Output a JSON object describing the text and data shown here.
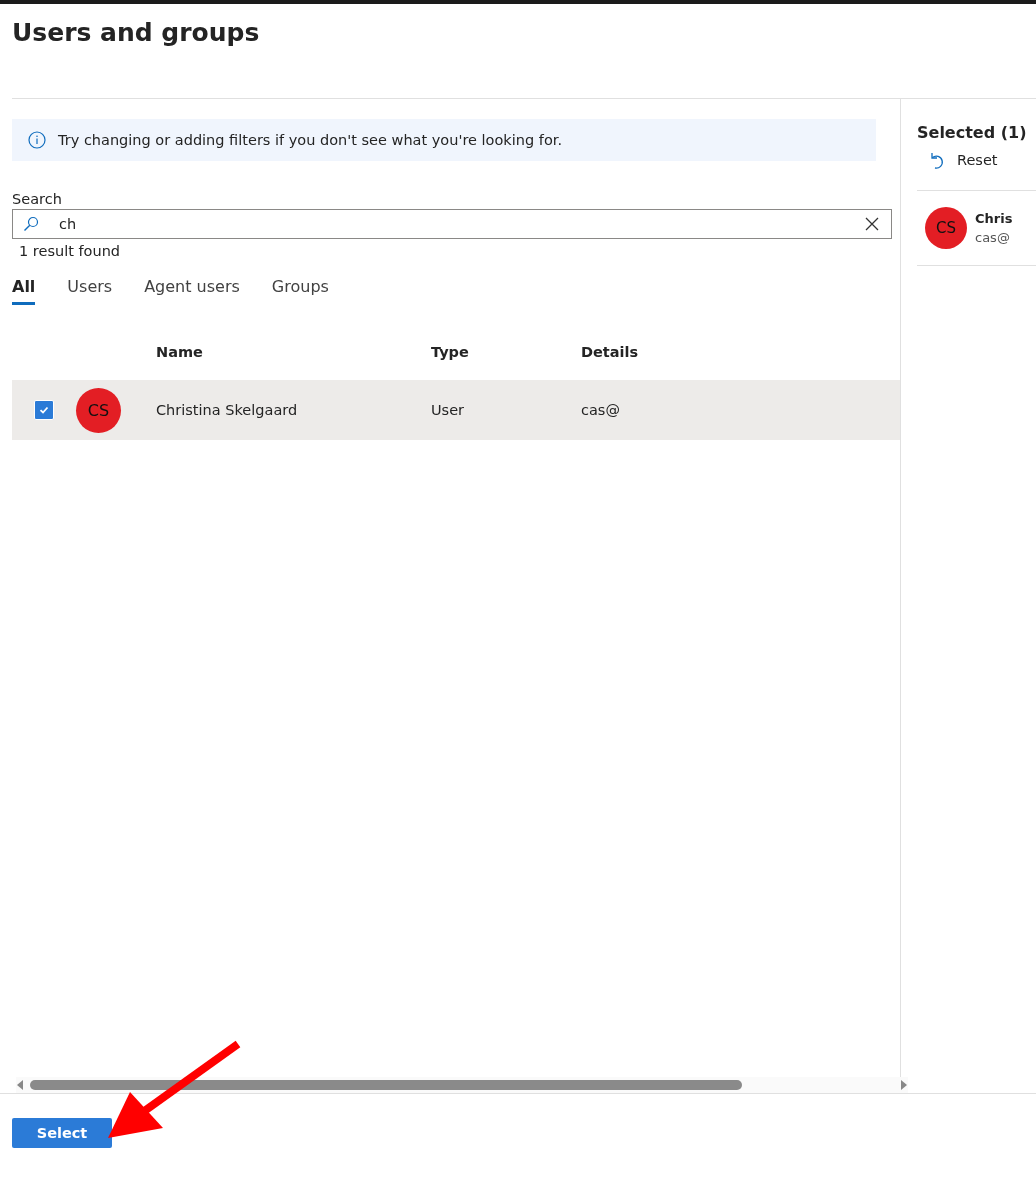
{
  "title": "Users and groups",
  "info_banner": "Try changing or adding filters if you don't see what you're looking for.",
  "search": {
    "label": "Search",
    "value": "ch",
    "result_count": "1 result found"
  },
  "tabs": [
    {
      "label": "All",
      "selected": true
    },
    {
      "label": "Users",
      "selected": false
    },
    {
      "label": "Agent users",
      "selected": false
    },
    {
      "label": "Groups",
      "selected": false
    }
  ],
  "table": {
    "columns": [
      "Name",
      "Type",
      "Details"
    ],
    "rows": [
      {
        "initials": "CS",
        "color": "#e31e24",
        "name": "Christina Skelgaard",
        "type": "User",
        "details": "cas@",
        "checked": true,
        "selected": true
      }
    ]
  },
  "selected_panel": {
    "title": "Selected (1)",
    "reset": "Reset",
    "items": [
      {
        "initials": "CS",
        "color": "#e31e24",
        "name": "Chris",
        "details": "cas@"
      }
    ]
  },
  "select_button": "Select"
}
